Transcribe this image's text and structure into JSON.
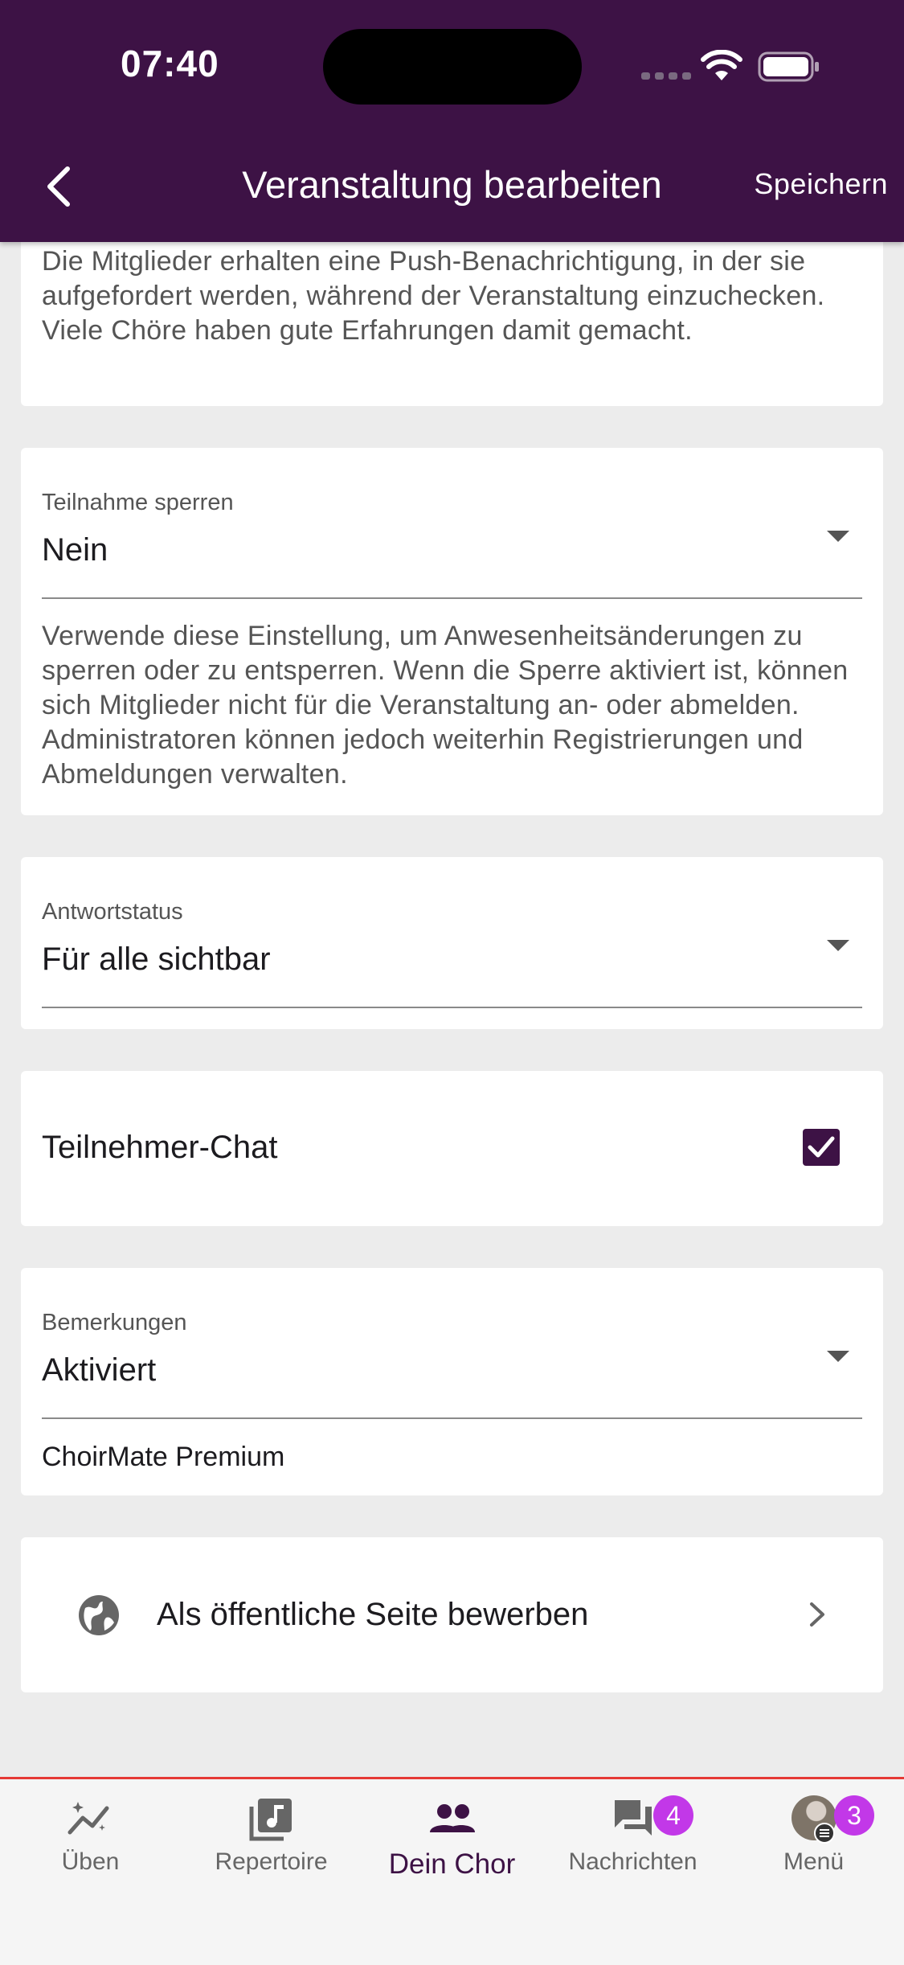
{
  "status_bar": {
    "time": "07:40"
  },
  "header": {
    "title": "Veranstaltung bearbeiten",
    "save_label": "Speichern"
  },
  "checkin_card": {
    "help": "Die Mitglieder erhalten eine Push-Benachrichtigung, in der sie aufgefordert werden, während der Veranstaltung einzuchecken. Viele Chöre haben gute Erfahrungen damit gemacht."
  },
  "lock_card": {
    "label": "Teilnahme sperren",
    "value": "Nein",
    "help": "Verwende diese Einstellung, um Anwesenheitsänderungen zu sperren oder zu entsperren. Wenn die Sperre aktiviert ist, können sich Mitglieder nicht für die Veranstaltung an- oder abmelden. Administratoren können jedoch weiterhin Registrierungen und Abmeldungen verwalten."
  },
  "response_card": {
    "label": "Antwortstatus",
    "value": "Für alle sichtbar"
  },
  "chat_card": {
    "label": "Teilnehmer-Chat",
    "checked": true
  },
  "remarks_card": {
    "label": "Bemerkungen",
    "value": "Aktiviert",
    "note": "ChoirMate Premium"
  },
  "public_card": {
    "label": "Als öffentliche Seite bewerben",
    "icon": "globe-icon"
  },
  "bottom_nav": {
    "items": [
      {
        "label": "Üben",
        "icon": "practice-icon"
      },
      {
        "label": "Repertoire",
        "icon": "music-note-icon"
      },
      {
        "label": "Dein Chor",
        "icon": "group-icon",
        "active": true
      },
      {
        "label": "Nachrichten",
        "icon": "chat-icon",
        "badge": "4"
      },
      {
        "label": "Menü",
        "icon": "avatar-icon",
        "badge": "3"
      }
    ]
  },
  "colors": {
    "primary": "#3d1245",
    "badge": "#c238e8",
    "background": "#ececec"
  }
}
